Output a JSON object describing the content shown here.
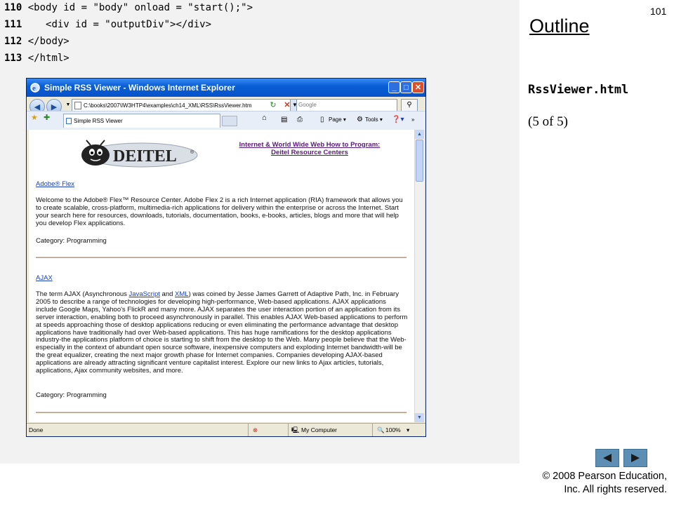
{
  "code": [
    {
      "num": "110",
      "text": "<body id = \"body\" onload = \"start();\">"
    },
    {
      "num": "111",
      "text": "   <div id = \"outputDiv\"></div>"
    },
    {
      "num": "112",
      "text": "</body>"
    },
    {
      "num": "113",
      "text": "</html>"
    }
  ],
  "slide": {
    "number": "101",
    "outline_title": "Outline",
    "filename": "RssViewer.html",
    "part": "(5 of 5)",
    "copyright_line1": "© 2008 Pearson Education,",
    "copyright_line2": "Inc.  All rights reserved.",
    "nav": {
      "prev_icon": "triangle-left-icon",
      "next_icon": "triangle-right-icon"
    }
  },
  "browser": {
    "title": "Simple RSS Viewer - Windows Internet Explorer",
    "address": "C:\\books\\2007\\IW3HTP4\\examples\\ch14_XML\\RSS\\RssViewer.htm",
    "search_placeholder": "Google",
    "tab_label": "Simple RSS Viewer",
    "commands": {
      "page": "Page",
      "tools": "Tools"
    },
    "status": {
      "left": "Done",
      "zone": "My Computer",
      "zoom": "100%"
    },
    "colors": {
      "titlebar": "#0a5fd6",
      "link": "#1a3fb0",
      "visited": "#5a1a7a"
    }
  },
  "page": {
    "logo_text": "DEITEL",
    "logo_mark": "®",
    "banner_line1": "Internet & World Wide Web How to Program:",
    "banner_line2": "Deitel Resource Centers",
    "items": [
      {
        "title": "Adobe® Flex",
        "desc": "Welcome to the Adobe® Flex™ Resource Center. Adobe Flex 2 is a rich Internet application (RIA) framework that allows you to create scalable, cross-platform, multimedia-rich applications for delivery within the enterprise or across the Internet. Start your search here for resources, downloads, tutorials, documentation, books, e-books, articles, blogs and more that will help you develop Flex applications.",
        "category": "Category: Programming"
      },
      {
        "title": "AJAX",
        "desc_pre": "The term AJAX (Asynchronous ",
        "desc_link1": "JavaScript",
        "desc_mid": " and ",
        "desc_link2": "XML",
        "desc_post": ") was coined by Jesse James Garrett of Adaptive Path, Inc. in February 2005 to describe a range of technologies for developing high-performance, Web-based applications. AJAX applications include Google Maps, Yahoo's FlickR and many more. AJAX separates the user interaction portion of an application from its server interaction, enabling both to proceed asynchronously in parallel. This enables AJAX Web-based applications to perform at speeds approaching those of desktop applications reducing or even eliminating the performance advantage that desktop applications have traditionally had over Web-based applications. This has huge ramifications for the desktop applications industry-the applications platform of choice is starting to shift from the desktop to the Web. Many people believe that the Web-especially in the context of abundant open source software, inexpensive computers and exploding Internet bandwidth-will be the great equalizer, creating the next major growth phase for Internet companies. Companies developing AJAX-based applications are already attracting significant venture capitalist interest. Explore our new links to Ajax articles, tutorials, applications, Ajax community websites, and more.",
        "category": "Category: Programming"
      }
    ]
  }
}
